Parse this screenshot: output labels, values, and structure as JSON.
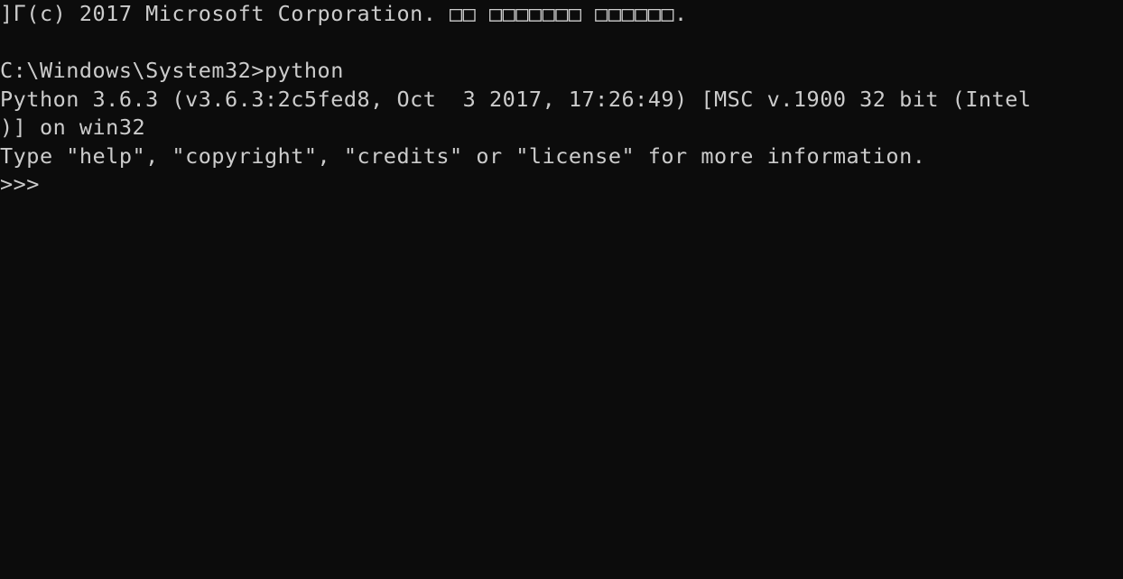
{
  "console": {
    "lines": [
      "]Γ(c) 2017 Microsoft Corporation. □□ □□□□□□□ □□□□□□.",
      "",
      "C:\\Windows\\System32>python",
      "Python 3.6.3 (v3.6.3:2c5fed8, Oct  3 2017, 17:26:49) [MSC v.1900 32 bit (Intel",
      ")] on win32",
      "Type \"help\", \"copyright\", \"credits\" or \"license\" for more information.",
      ">>>"
    ]
  },
  "colors": {
    "background": "#0c0c0c",
    "text": "#cccccc"
  }
}
